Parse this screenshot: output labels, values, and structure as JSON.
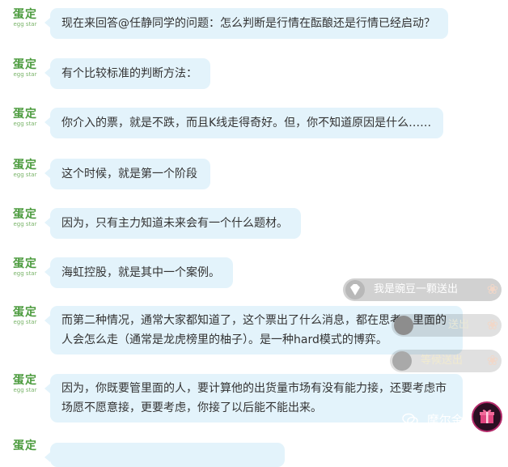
{
  "avatar": {
    "brand_cn": "蛋定",
    "brand_en": "egg star"
  },
  "messages": [
    {
      "text": "现在来回答@任静同学的问题：怎么判断是行情在酝酿还是行情已经启动？"
    },
    {
      "text": "有个比较标准的判断方法："
    },
    {
      "text": "你介入的票，就是不跌，而且K线走得奇好。但，你不知道原因是什么……"
    },
    {
      "text": "这个时候，就是第一个阶段"
    },
    {
      "text": "因为，只有主力知道未来会有一个什么题材。"
    },
    {
      "text": "海虹控股，就是其中一个案例。"
    },
    {
      "text": "而第二种情况，通常大家都知道了，这个票出了什么消息，都在思考，里面的人会怎么走（通常是龙虎榜里的柚子）。是一种hard模式的博弈。"
    },
    {
      "text": "因为，你既要管里面的人，要计算他的出货量市场有没有能力接，还要考虑市场愿不愿意接，更要考虑，你接了以后能不能出来。"
    }
  ],
  "danmaku": [
    {
      "text": "我是豌豆一颗送出",
      "icon": "diamond-icon"
    },
    {
      "text": "送出",
      "icon": "avatar-icon"
    },
    {
      "text": "等候送出",
      "icon": "avatar-icon"
    }
  ],
  "watermark": {
    "text": "摩尔金融",
    "icon": "wechat-icon"
  },
  "colors": {
    "bubble": "#e3f3fb",
    "text": "#333333",
    "brand_green": "#4a9a3c",
    "overlay": "#000000"
  }
}
